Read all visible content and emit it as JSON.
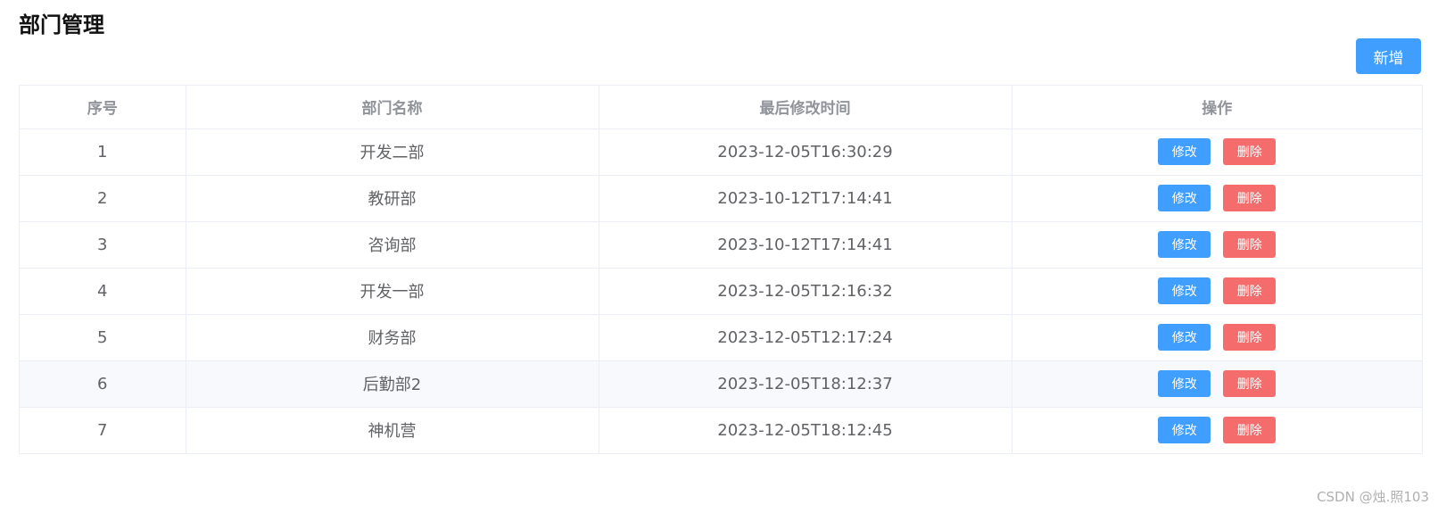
{
  "page": {
    "title": "部门管理",
    "add_label": "新增"
  },
  "table": {
    "headers": {
      "index": "序号",
      "name": "部门名称",
      "updated": "最后修改时间",
      "actions": "操作"
    },
    "rows": [
      {
        "index": "1",
        "name": "开发二部",
        "updated": "2023-12-05T16:30:29",
        "edit": "修改",
        "delete": "删除"
      },
      {
        "index": "2",
        "name": "教研部",
        "updated": "2023-10-12T17:14:41",
        "edit": "修改",
        "delete": "删除"
      },
      {
        "index": "3",
        "name": "咨询部",
        "updated": "2023-10-12T17:14:41",
        "edit": "修改",
        "delete": "删除"
      },
      {
        "index": "4",
        "name": "开发一部",
        "updated": "2023-12-05T12:16:32",
        "edit": "修改",
        "delete": "删除"
      },
      {
        "index": "5",
        "name": "财务部",
        "updated": "2023-12-05T12:17:24",
        "edit": "修改",
        "delete": "删除"
      },
      {
        "index": "6",
        "name": "后勤部2",
        "updated": "2023-12-05T18:12:37",
        "edit": "修改",
        "delete": "删除"
      },
      {
        "index": "7",
        "name": "神机营",
        "updated": "2023-12-05T18:12:45",
        "edit": "修改",
        "delete": "删除"
      }
    ]
  },
  "watermark": "CSDN @烛.照103",
  "colors": {
    "primary": "#409eff",
    "danger": "#f56c6c",
    "border": "#ebeef5",
    "header_text": "#909399",
    "body_text": "#606266"
  }
}
